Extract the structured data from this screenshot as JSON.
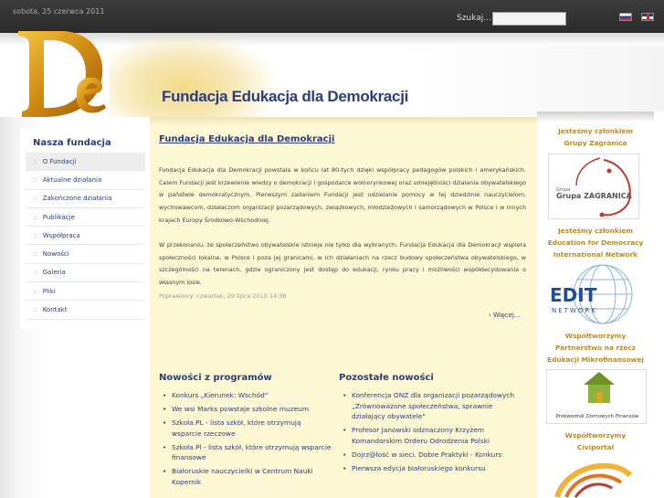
{
  "header": {
    "date": "sobota, 25 czerwca 2011",
    "search_label": "Szukaj...",
    "search_value": "",
    "languages": [
      "ru-flag-icon",
      "gb-flag-icon"
    ]
  },
  "banner": {
    "logo_text": "De",
    "site_title": "Fundacja Edukacja dla Demokracji"
  },
  "nav": {
    "title": "Nasza fundacja",
    "items": [
      {
        "label": "O Fundacji"
      },
      {
        "label": "Aktualne działania"
      },
      {
        "label": "Zakończone działania"
      },
      {
        "label": "Publikacje"
      },
      {
        "label": "Współpraca"
      },
      {
        "label": "Nowości"
      },
      {
        "label": "Galeria"
      },
      {
        "label": "Pliki"
      },
      {
        "label": "Kontakt"
      }
    ]
  },
  "article": {
    "title": "Fundacja Edukacja dla Demokracji",
    "para1": "Fundacja Edukacja dla Demokracji powstała w końcu lat 80-tych dzięki współpracy pedagogów polskich i amerykańskich. Celem Fundacji jest krzewienie wiedzy o demokracji i gospodarce wolnorynkowej oraz umiejętności działania obywatelskiego w państwie demokratycznym. Pierwszym zadaniem Fundacji jest udzielanie pomocy w tej dziedzinie nauczycielom, wychowawcom, działaczom organizacji pozarządowych, związkowych, młodzieżowych i samorządowych w Polsce i w innych krajach Europy Środkowo-Wschodniej.",
    "para2": "W przekonaniu, że społeczeństwo obywatelskie istnieje nie tylko dla wybranych, Fundacja Edukacja dla Demokracji wspiera społeczności lokalne, w Polsce i poza jej granicami, w ich działaniach na rzecz budowy społeczeństwa obywatelskiego, w szczególności na terenach, gdzie ograniczony jest dostęp do edukacji, rynku pracy i możliwości współdecydowania o własnym losie.",
    "modified": "Poprawiony: czwartek, 29 lipca 2010 14:38",
    "more": "Więcej..."
  },
  "news_programs": {
    "title": "Nowości z programów",
    "items": [
      "Konkurs „Kierunek: Wschód\"",
      "We wsi Marks powstaje szkolne muzeum",
      "Szkoła.PL - lista szkół, które otrzymują wsparcie rzeczowe",
      "Szkoła.Pl - lista szkół, które otrzymują wsparcie finansowe",
      "Białoruskie nauczycielki w Centrum Nauki Kopernik"
    ]
  },
  "news_other": {
    "title": "Pozostałe nowości",
    "items": [
      "Konferencja ONZ dla organizacji pozarządowych „Zrównoważone społeczeństwa, sprawnie działający obywatele\"",
      "Profesor Janowski odznaczony Krzyżem Komandorskim Orderu Odrodzenia Polski",
      "Dojrz@łość w sieci. Dobre Praktyki - Konkurs",
      "Pierwsza edycja białoruskiego konkursu"
    ]
  },
  "sidebar": {
    "block1": {
      "heading": "Jesteśmy członkiem Grupy Zagranica",
      "image_label": "Grupa ZAGRANICA"
    },
    "block2": {
      "heading": "Jesteśmy członkiem Education for Democracy International Network",
      "image_label": "EDIT NETWORK"
    },
    "block3": {
      "heading": "Współtworzymy Partnerstwo na rzecz Edukacji Mikrofinansowej",
      "image_label": "Przewodnik Domowych Finansów"
    },
    "block4": {
      "heading": "Współtworzymy Civiportal"
    }
  },
  "colors": {
    "accent_blue": "#2c3e7a",
    "accent_gold": "#c28a1a",
    "content_bg": "#fdf7d4",
    "topbar": "#333333"
  }
}
